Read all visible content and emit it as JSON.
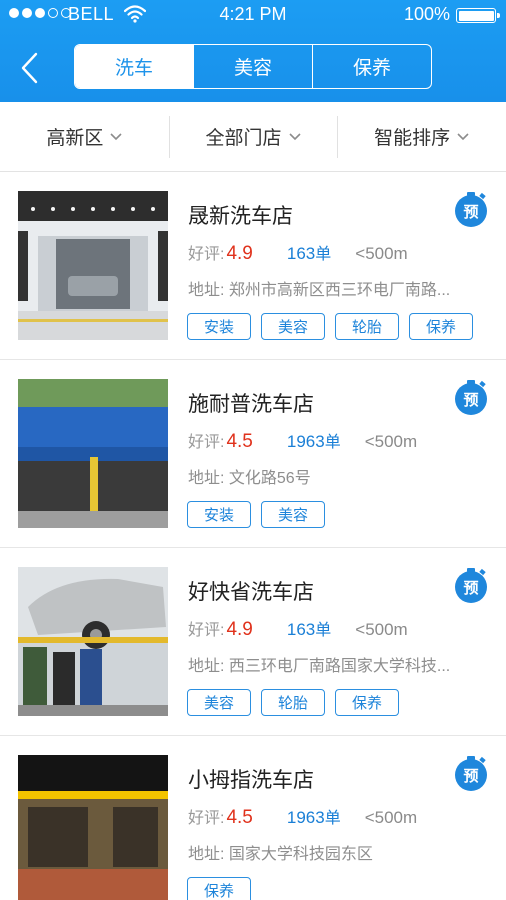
{
  "status_bar": {
    "carrier": "BELL",
    "time": "4:21 PM",
    "battery": "100%"
  },
  "nav": {
    "back_icon": "chevron-left-icon",
    "tabs": [
      {
        "label": "洗车",
        "active": true
      },
      {
        "label": "美容",
        "active": false
      },
      {
        "label": "保养",
        "active": false
      }
    ]
  },
  "filters": [
    {
      "label": "高新区"
    },
    {
      "label": "全部门店"
    },
    {
      "label": "智能排序"
    }
  ],
  "labels": {
    "rating_prefix": "好评:",
    "address_prefix": "地址:",
    "orders_unit": "单",
    "book_badge": "预"
  },
  "stores": [
    {
      "name": "晟新洗车店",
      "rating": "4.9",
      "orders": "163",
      "distance": "<500m",
      "address": "郑州市高新区西三环电厂南路...",
      "tags": [
        "安装",
        "美容",
        "轮胎",
        "保养"
      ]
    },
    {
      "name": "施耐普洗车店",
      "rating": "4.5",
      "orders": "1963",
      "distance": "<500m",
      "address": "文化路56号",
      "tags": [
        "安装",
        "美容"
      ]
    },
    {
      "name": "好快省洗车店",
      "rating": "4.9",
      "orders": "163",
      "distance": "<500m",
      "address": "西三环电厂南路国家大学科技...",
      "tags": [
        "美容",
        "轮胎",
        "保养"
      ]
    },
    {
      "name": "小拇指洗车店",
      "rating": "4.5",
      "orders": "1963",
      "distance": "<500m",
      "address": "国家大学科技园东区",
      "tags": [
        "保养"
      ]
    }
  ],
  "colors": {
    "header_blue": "#1c9df3",
    "accent_blue": "#1d84da",
    "rating_red": "#e0321c"
  }
}
